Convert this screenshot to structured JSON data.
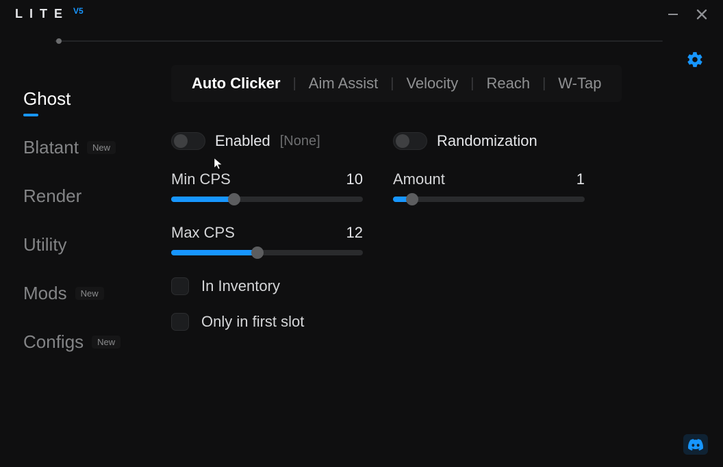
{
  "brand": {
    "name": "LITE",
    "version": "V5"
  },
  "badges": {
    "new": "New"
  },
  "sidebar": {
    "items": [
      {
        "label": "Ghost",
        "active": true,
        "badge": null
      },
      {
        "label": "Blatant",
        "active": false,
        "badge": "new"
      },
      {
        "label": "Render",
        "active": false,
        "badge": null
      },
      {
        "label": "Utility",
        "active": false,
        "badge": null
      },
      {
        "label": "Mods",
        "active": false,
        "badge": "new"
      },
      {
        "label": "Configs",
        "active": false,
        "badge": "new"
      }
    ]
  },
  "tabs": {
    "items": [
      {
        "label": "Auto Clicker",
        "active": true
      },
      {
        "label": "Aim Assist",
        "active": false
      },
      {
        "label": "Velocity",
        "active": false
      },
      {
        "label": "Reach",
        "active": false
      },
      {
        "label": "W-Tap",
        "active": false
      }
    ]
  },
  "module": {
    "enabled": {
      "label": "Enabled",
      "state": false,
      "keybind": "[None]"
    },
    "randomization": {
      "label": "Randomization",
      "state": false
    },
    "sliders": {
      "min_cps": {
        "label": "Min CPS",
        "value": 10,
        "fill_pct": 30
      },
      "max_cps": {
        "label": "Max CPS",
        "value": 12,
        "fill_pct": 42
      },
      "amount": {
        "label": "Amount",
        "value": 1,
        "fill_pct": 8
      }
    },
    "checks": {
      "in_inventory": {
        "label": "In Inventory",
        "checked": false
      },
      "only_first_slot": {
        "label": "Only in first slot",
        "checked": false
      }
    }
  },
  "colors": {
    "accent": "#1796ff",
    "bg": "#0f0f10"
  }
}
